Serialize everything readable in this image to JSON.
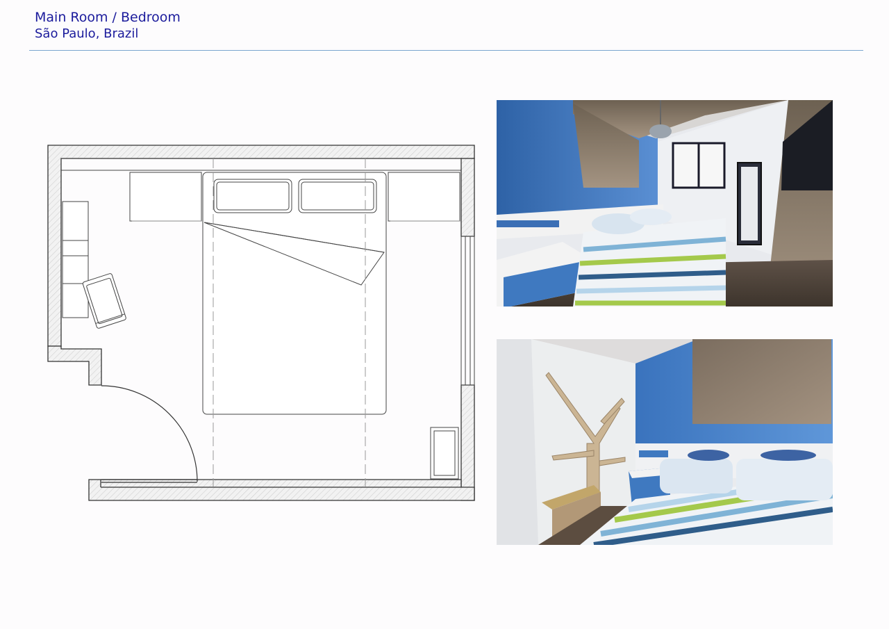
{
  "header": {
    "title": "Main Room / Bedroom",
    "subtitle": "São Paulo, Brazil"
  },
  "colors": {
    "title_text": "#1b1b9c",
    "rule": "#7aa6cf",
    "wall_blue": "#3f79c0",
    "wood": "#8a7a6a",
    "plan_line": "#333333"
  },
  "floor_plan": {
    "fixtures": [
      "wall-shelf",
      "armchair",
      "nightstand-left",
      "double-bed",
      "pillow-left",
      "pillow-right",
      "nightstand-right",
      "door-swing",
      "window",
      "wardrobe"
    ]
  },
  "renders": {
    "top": {
      "subject": "bedroom-view-window-tv"
    },
    "bottom": {
      "subject": "bedroom-view-tree-shelf"
    }
  }
}
